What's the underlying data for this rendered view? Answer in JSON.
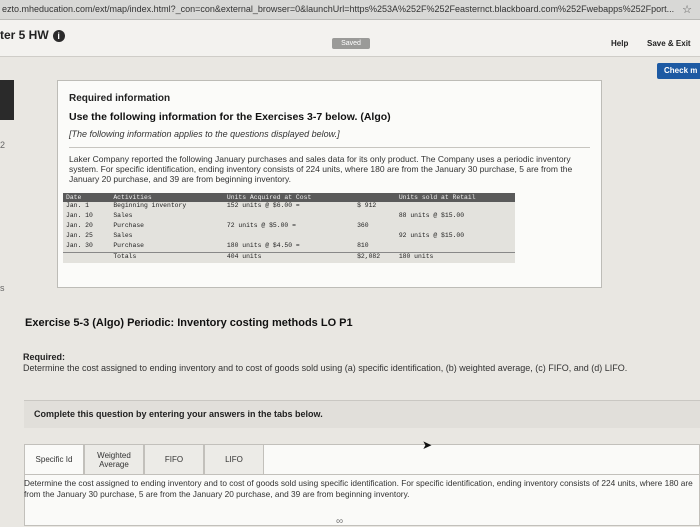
{
  "browser": {
    "url": "ezto.mheducation.com/ext/map/index.html?_con=con&external_browser=0&launchUrl=https%253A%252F%252Feasternct.blackboard.com%252Fwebapps%252Fport..."
  },
  "app": {
    "chapter_label": "ter 5 HW",
    "saved_label": "Saved",
    "help_label": "Help",
    "save_exit_label": "Save & Exit",
    "check_label": "Check m",
    "left_number_1": "2",
    "left_number_2": "s"
  },
  "required_info": {
    "title": "Required information",
    "subtitle": "Use the following information for the Exercises 3-7 below. (Algo)",
    "note": "[The following information applies to the questions displayed below.]",
    "description": "Laker Company reported the following January purchases and sales data for its only product. The Company uses a periodic inventory system. For specific identification, ending inventory consists of 224 units, where 180 are from the January 30 purchase, 5 are from the January 20 purchase, and 39 are from beginning inventory."
  },
  "table": {
    "headers": [
      "Date",
      "Activities",
      "Units Acquired at Cost",
      "",
      "Units sold at Retail"
    ],
    "rows": [
      [
        "Jan. 1",
        "Beginning inventory",
        "152 units @ $6.00 =",
        "$ 912",
        ""
      ],
      [
        "Jan. 10",
        "Sales",
        "",
        "",
        "88 units @ $15.00"
      ],
      [
        "Jan. 20",
        "Purchase",
        "72 units @ $5.00 =",
        "360",
        ""
      ],
      [
        "Jan. 25",
        "Sales",
        "",
        "",
        "92 units @ $15.00"
      ],
      [
        "Jan. 30",
        "Purchase",
        "180 units @ $4.50 =",
        "810",
        ""
      ]
    ],
    "totals": [
      "",
      "Totals",
      "404 units",
      "$2,082",
      "180 units"
    ]
  },
  "exercise": {
    "title": "Exercise 5-3 (Algo) Periodic: Inventory costing methods LO P1",
    "required_label": "Required:",
    "required_text": "Determine the cost assigned to ending inventory and to cost of goods sold using (a) specific identification, (b) weighted average, (c) FIFO, and (d) LIFO.",
    "complete_prompt": "Complete this question by entering your answers in the tabs below."
  },
  "tabs": [
    {
      "label": "Specific Id"
    },
    {
      "label": "Weighted Average"
    },
    {
      "label": "FIFO"
    },
    {
      "label": "LIFO"
    }
  ],
  "tab_content": {
    "text": "Determine the cost assigned to ending inventory and to cost of goods sold using specific identification. For specific identification, ending inventory consists of 224 units, where 180 are from the January 30 purchase, 5 are from the January 20 purchase, and 39 are from beginning inventory."
  }
}
